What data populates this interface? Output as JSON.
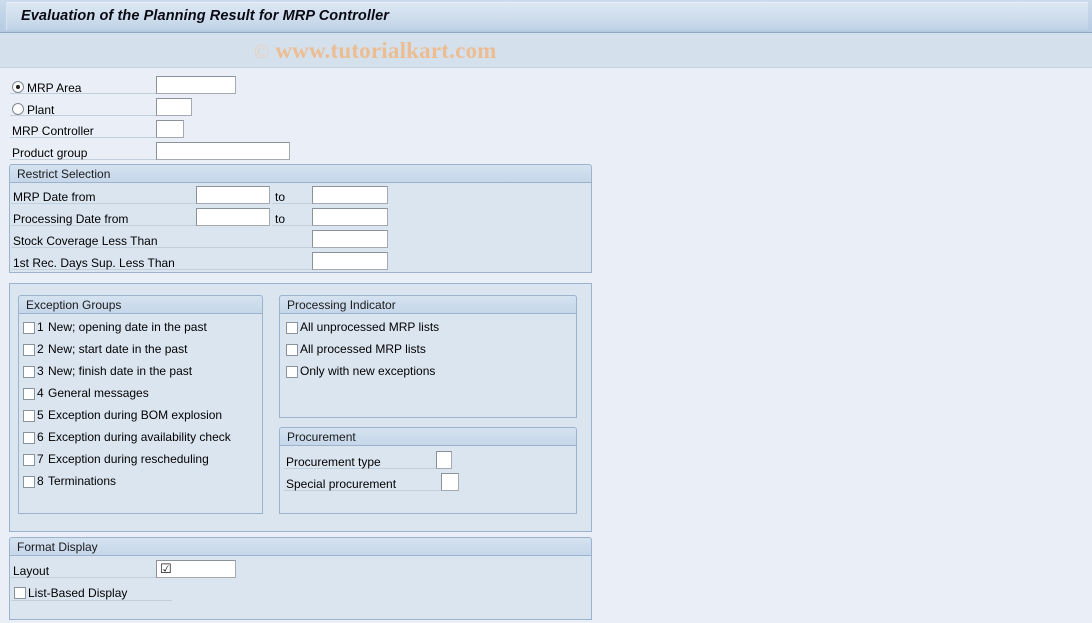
{
  "window": {
    "title": "Evaluation of the Planning Result for MRP Controller"
  },
  "watermark": {
    "copyright": "©",
    "text": "www.tutorialkart.com",
    "color": "#edbd92"
  },
  "selection": {
    "mrp_area": {
      "label": "MRP Area",
      "selected": true,
      "value": ""
    },
    "plant": {
      "label": "Plant",
      "selected": false,
      "value": ""
    },
    "mrp_controller": {
      "label": "MRP Controller",
      "value": ""
    },
    "product_group": {
      "label": "Product group",
      "value": ""
    }
  },
  "restrict_selection": {
    "title": "Restrict Selection",
    "to_label_1": "to",
    "to_label_2": "to",
    "rows": [
      {
        "label": "MRP Date from",
        "from": "",
        "to": ""
      },
      {
        "label": "Processing Date from",
        "from": "",
        "to": ""
      }
    ],
    "stock_coverage": {
      "label": "Stock Coverage Less Than",
      "value": ""
    },
    "first_rec_days": {
      "label": "1st Rec. Days Sup. Less Than",
      "value": ""
    }
  },
  "exception_groups": {
    "title": "Exception Groups",
    "items": [
      {
        "num": "1",
        "label": "New; opening date in the past",
        "checked": false
      },
      {
        "num": "2",
        "label": "New; start date in the past",
        "checked": false
      },
      {
        "num": "3",
        "label": "New; finish date in the past",
        "checked": false
      },
      {
        "num": "4",
        "label": "General messages",
        "checked": false
      },
      {
        "num": "5",
        "label": "Exception during BOM explosion",
        "checked": false
      },
      {
        "num": "6",
        "label": "Exception during availability check",
        "checked": false
      },
      {
        "num": "7",
        "label": "Exception during rescheduling",
        "checked": false
      },
      {
        "num": "8",
        "label": "Terminations",
        "checked": false
      }
    ]
  },
  "processing_indicator": {
    "title": "Processing Indicator",
    "items": [
      {
        "label": "All unprocessed MRP lists",
        "checked": false
      },
      {
        "label": "All processed MRP lists",
        "checked": false
      },
      {
        "label": "Only with new exceptions",
        "checked": false
      }
    ]
  },
  "procurement": {
    "title": "Procurement",
    "rows": [
      {
        "label": "Procurement type",
        "value": ""
      },
      {
        "label": "Special procurement",
        "value": ""
      }
    ]
  },
  "format_display": {
    "title": "Format Display",
    "layout": {
      "label": "Layout",
      "value": "",
      "icon": "checkbox-checked-glyph"
    },
    "list_based_display": {
      "label": "List-Based Display",
      "checked": false
    }
  }
}
